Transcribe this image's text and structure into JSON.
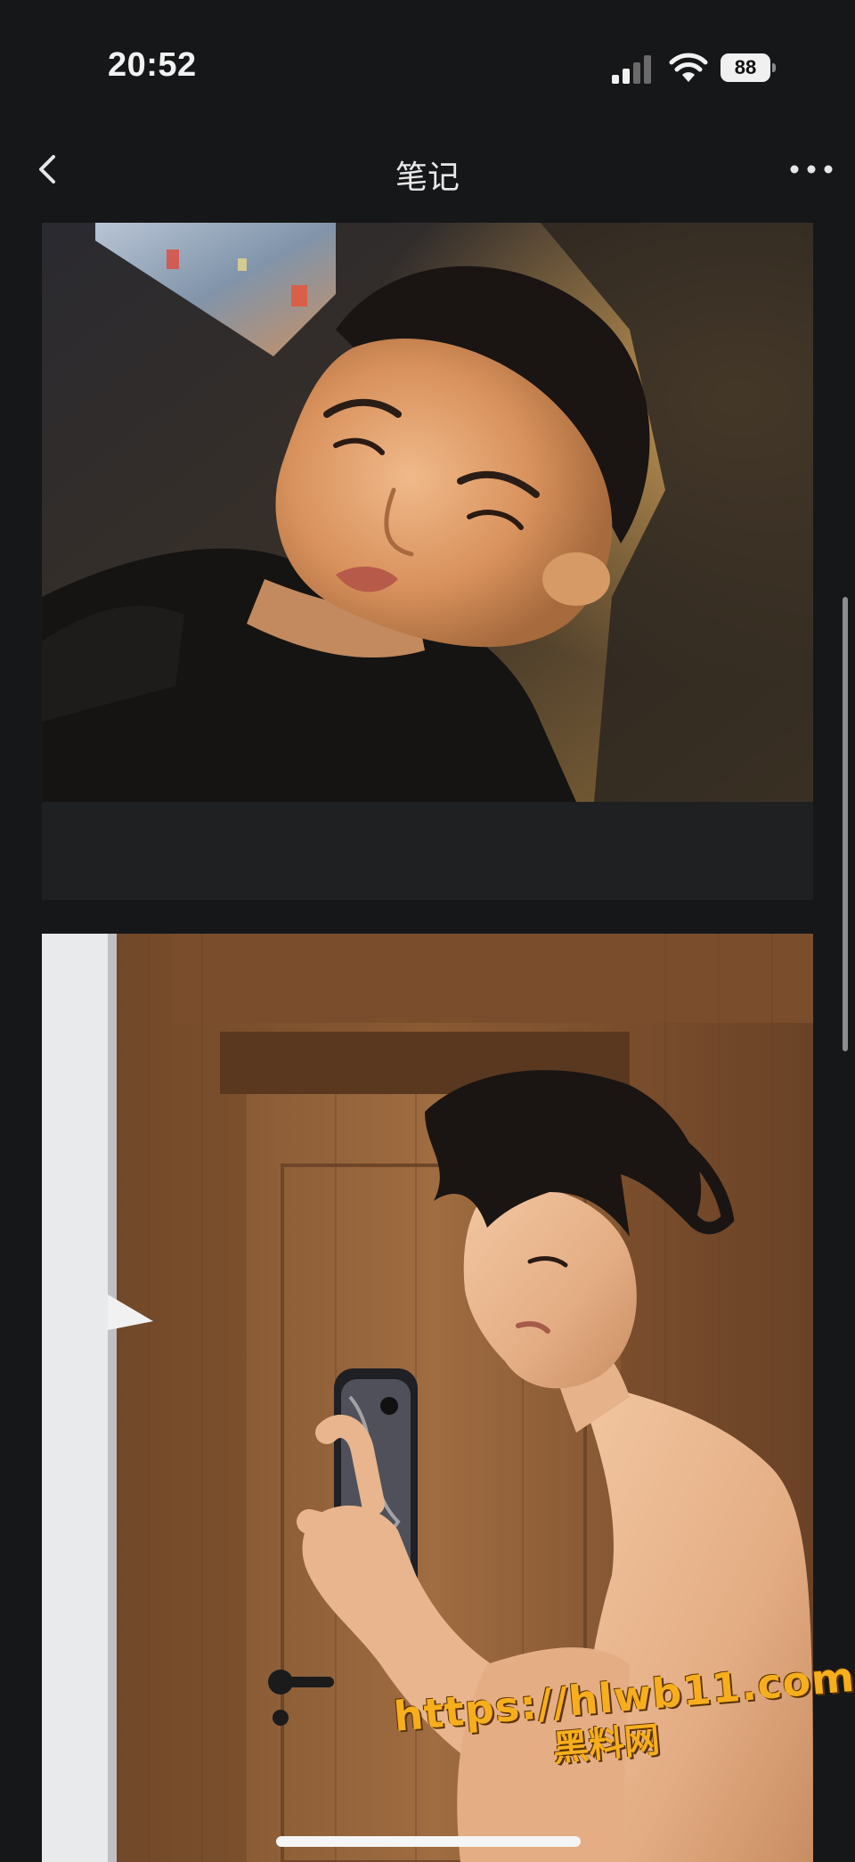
{
  "status_bar": {
    "time": "20:52",
    "battery_level": "88",
    "icons": [
      "signal-icon",
      "wifi-icon",
      "battery-icon"
    ]
  },
  "nav": {
    "title": "笔记",
    "back_icon": "chevron-left-icon",
    "more_icon": "ellipsis-icon"
  },
  "feed": {
    "photos": [
      {
        "name": "selfie-in-car-photo"
      },
      {
        "name": "mirror-selfie-photo"
      }
    ]
  },
  "watermark": {
    "url": "https://hlwb11.com",
    "name": "黑料网"
  },
  "colors": {
    "background": "#161719",
    "watermark": "#f6ae1c",
    "text": "#ececec"
  }
}
